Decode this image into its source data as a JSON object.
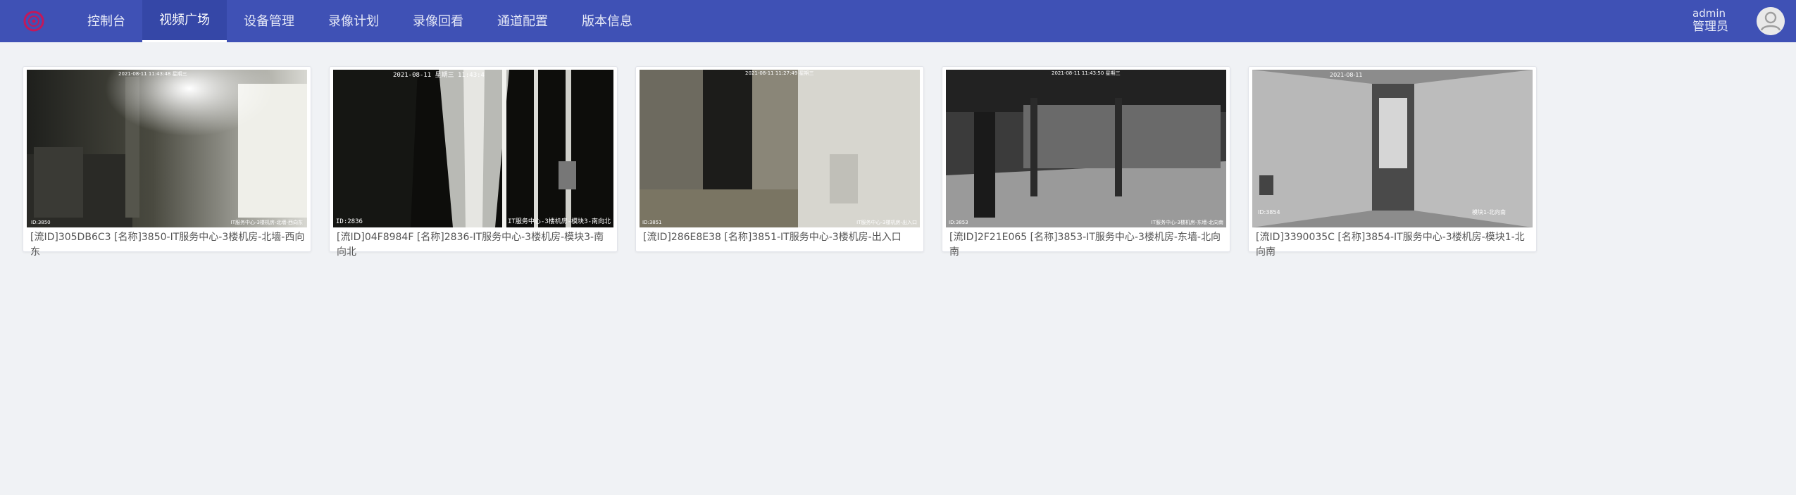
{
  "app": {
    "user_name": "admin",
    "user_role": "管理员"
  },
  "nav": {
    "items": [
      {
        "label": "控制台",
        "active": false
      },
      {
        "label": "视频广场",
        "active": true
      },
      {
        "label": "设备管理",
        "active": false
      },
      {
        "label": "录像计划",
        "active": false
      },
      {
        "label": "录像回看",
        "active": false
      },
      {
        "label": "通道配置",
        "active": false
      },
      {
        "label": "版本信息",
        "active": false
      }
    ]
  },
  "colors": {
    "header": "#3f51b5",
    "header_active": "#3547a7",
    "background": "#f0f2f5"
  },
  "videos": [
    {
      "caption": "[流ID]305DB6C3 [名称]3850-IT服务中心-3楼机房-北墙-西向东",
      "osd_top": "2021-08-11 11:43:48 星期三",
      "osd_left": "ID:3850",
      "osd_right": "IT服务中心-3楼机房-北墙-西向东"
    },
    {
      "caption": "[流ID]04F8984F [名称]2836-IT服务中心-3楼机房-模块3-南向北",
      "osd_top": "2021-08-11 星期三 11:43:4",
      "osd_left": "ID:2836",
      "osd_right": "IT服务中心-3楼机房-模块3-南向北"
    },
    {
      "caption": "[流ID]286E8E38 [名称]3851-IT服务中心-3楼机房-出入口",
      "osd_top": "2021-08-11 11:27:49 星期三",
      "osd_left": "ID:3851",
      "osd_right": "IT服务中心-3楼机房-出入口"
    },
    {
      "caption": "[流ID]2F21E065 [名称]3853-IT服务中心-3楼机房-东墙-北向南",
      "osd_top": "2021-08-11 11:43:50 星期三",
      "osd_left": "ID:3853",
      "osd_right": "IT服务中心-3楼机房-东墙-北向南"
    },
    {
      "caption": "[流ID]3390035C [名称]3854-IT服务中心-3楼机房-模块1-北向南",
      "osd_top": "2021-08-11",
      "osd_left": "ID:3854",
      "osd_right": "模块1-北向南"
    }
  ]
}
